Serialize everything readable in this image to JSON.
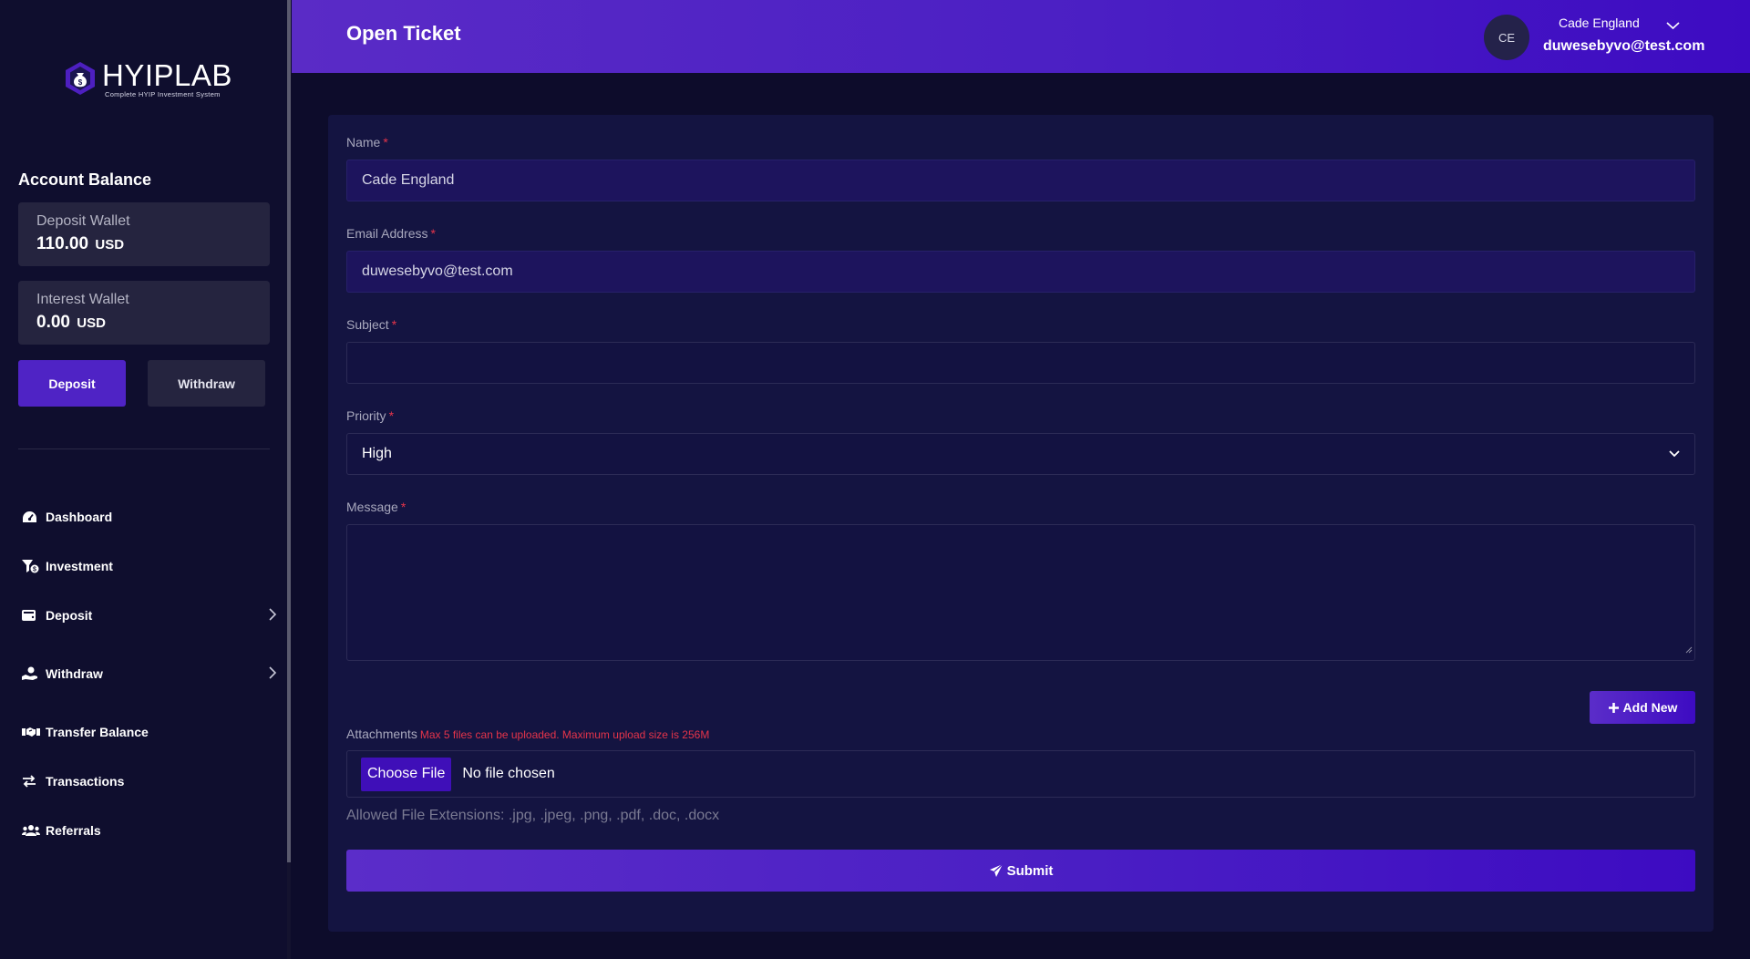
{
  "brand": {
    "name_part1": "HYIP",
    "name_part2": "LAB",
    "tagline": "Complete HYIP Investment System",
    "logo_icon": "money-bag-icon"
  },
  "header": {
    "page_title": "Open Ticket",
    "avatar_initials": "CE",
    "user_name": "Cade England",
    "user_email": "duwesebyvo@test.com"
  },
  "sidebar": {
    "balance_title": "Account Balance",
    "wallets": [
      {
        "label": "Deposit Wallet",
        "amount": "110.00",
        "currency": "USD"
      },
      {
        "label": "Interest Wallet",
        "amount": "0.00",
        "currency": "USD"
      }
    ],
    "deposit_button": "Deposit",
    "withdraw_button": "Withdraw",
    "nav": [
      {
        "label": "Dashboard",
        "icon": "gauge-icon"
      },
      {
        "label": "Investment",
        "icon": "funnel-dollar-icon"
      },
      {
        "label": "Deposit",
        "icon": "wallet-icon",
        "has_submenu": true
      },
      {
        "label": "Withdraw",
        "icon": "hand-money-icon",
        "has_submenu": true
      },
      {
        "label": "Transfer Balance",
        "icon": "handshake-icon"
      },
      {
        "label": "Transactions",
        "icon": "exchange-icon"
      },
      {
        "label": "Referrals",
        "icon": "users-icon"
      }
    ]
  },
  "form": {
    "name": {
      "label": "Name",
      "required_mark": "*",
      "value": "Cade England"
    },
    "email": {
      "label": "Email Address",
      "required_mark": "*",
      "value": "duwesebyvo@test.com"
    },
    "subject": {
      "label": "Subject",
      "required_mark": "*",
      "value": ""
    },
    "priority": {
      "label": "Priority",
      "required_mark": "*",
      "value": "High"
    },
    "message": {
      "label": "Message",
      "required_mark": "*",
      "value": ""
    },
    "add_new_button": "Add New",
    "attachments_label": "Attachments",
    "attachments_note": "Max 5 files can be uploaded. Maximum upload size is 256M",
    "choose_file_button": "Choose File",
    "no_file_text": "No file chosen",
    "allowed_extensions": "Allowed File Extensions: .jpg, .jpeg, .png, .pdf, .doc, .docx",
    "submit_button": "Submit"
  },
  "colors": {
    "accent": "#4f23c5",
    "required": "#e5344a",
    "page_bg": "#0d0c2b",
    "card_bg": "#141441"
  }
}
